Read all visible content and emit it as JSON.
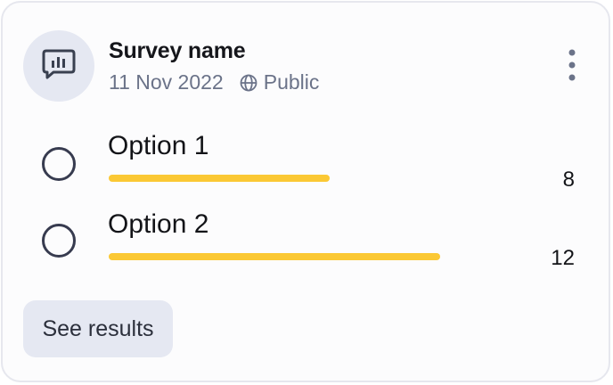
{
  "survey": {
    "title": "Survey name",
    "date": "11 Nov 2022",
    "visibility": "Public",
    "icon": "poll-chart-icon"
  },
  "options": [
    {
      "label": "Option 1",
      "count": "8",
      "fraction": 0.4
    },
    {
      "label": "Option 2",
      "count": "12",
      "fraction": 0.6
    }
  ],
  "actions": {
    "see_results_label": "See results"
  },
  "colors": {
    "accent_bar": "#fbc834",
    "avatar_bg": "#e5e8f2",
    "muted_text": "#6b7389"
  }
}
